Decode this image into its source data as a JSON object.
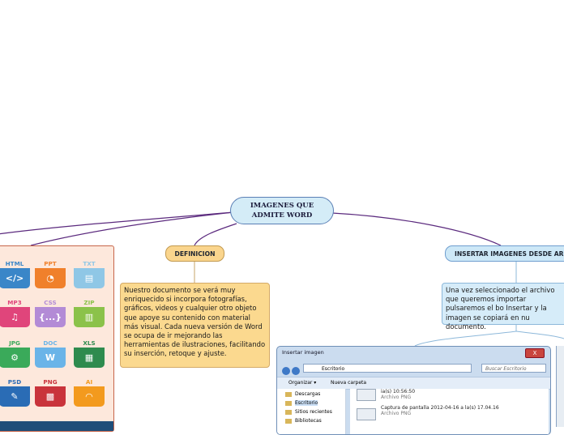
{
  "central": {
    "label": "IMAGENES QUE\nADMITE WORD"
  },
  "topics": {
    "definicion": "DEFINICION",
    "insertar": "INSERTAR IMAGENES DESDE ARCH"
  },
  "notes": {
    "definicion": "Nuestro documento se verá muy enriquecido si incorpora fotografías, gráficos, videos y cualquier otro objeto que apoye su contenido con material más visual.  Cada nueva versión de Word se ocupa de ir mejorando las herramientas de ilustraciones, facilitando su inserción, retoque y ajuste.",
    "insertar": "Una vez seleccionado el archivo que queremos importar pulsaremos el bo Insertar y la imagen se copiará en nu documento."
  },
  "file_icons": [
    {
      "label": "HTML",
      "glyph": "</>",
      "color": "#3a86c8"
    },
    {
      "label": "PPT",
      "glyph": "◔",
      "color": "#f0802b"
    },
    {
      "label": "TXT",
      "glyph": "▤",
      "color": "#8fc7e6"
    },
    {
      "label": "MP3",
      "glyph": "♫",
      "color": "#e0457b"
    },
    {
      "label": "CSS",
      "glyph": "{...}",
      "color": "#b38bd6"
    },
    {
      "label": "ZIP",
      "glyph": "▥",
      "color": "#8bc24a"
    },
    {
      "label": "JPG",
      "glyph": "⚙",
      "color": "#3aaa5a"
    },
    {
      "label": "DOC",
      "glyph": "W",
      "color": "#6ab4e8"
    },
    {
      "label": "XLS",
      "glyph": "▦",
      "color": "#2e8b4e"
    },
    {
      "label": "PSD",
      "glyph": "✎",
      "color": "#2a6cb5"
    },
    {
      "label": "PNG",
      "glyph": "▩",
      "color": "#c9333b"
    },
    {
      "label": "AI",
      "glyph": "◠",
      "color": "#f39a1e"
    }
  ],
  "dialog": {
    "title": "Insertar imagen",
    "close": "X",
    "address": "Escritorio",
    "search": "Buscar Escritorio",
    "organize": "Organizar ▾",
    "new_folder": "Nueva carpeta",
    "sidebar": [
      "Descargas",
      "Escritorio",
      "Sitios recientes",
      "Bibliotecas"
    ],
    "files": [
      {
        "name": "ia(s) 10:56:50",
        "type": "Archivo PNG"
      },
      {
        "name": "Captura de pantalla 2012-04-16 a la(s) 17.04.16",
        "type": "Archivo PNG"
      }
    ]
  },
  "colors": {
    "connector": "#5b2a7e",
    "connector_light": "#9fc3e3"
  }
}
